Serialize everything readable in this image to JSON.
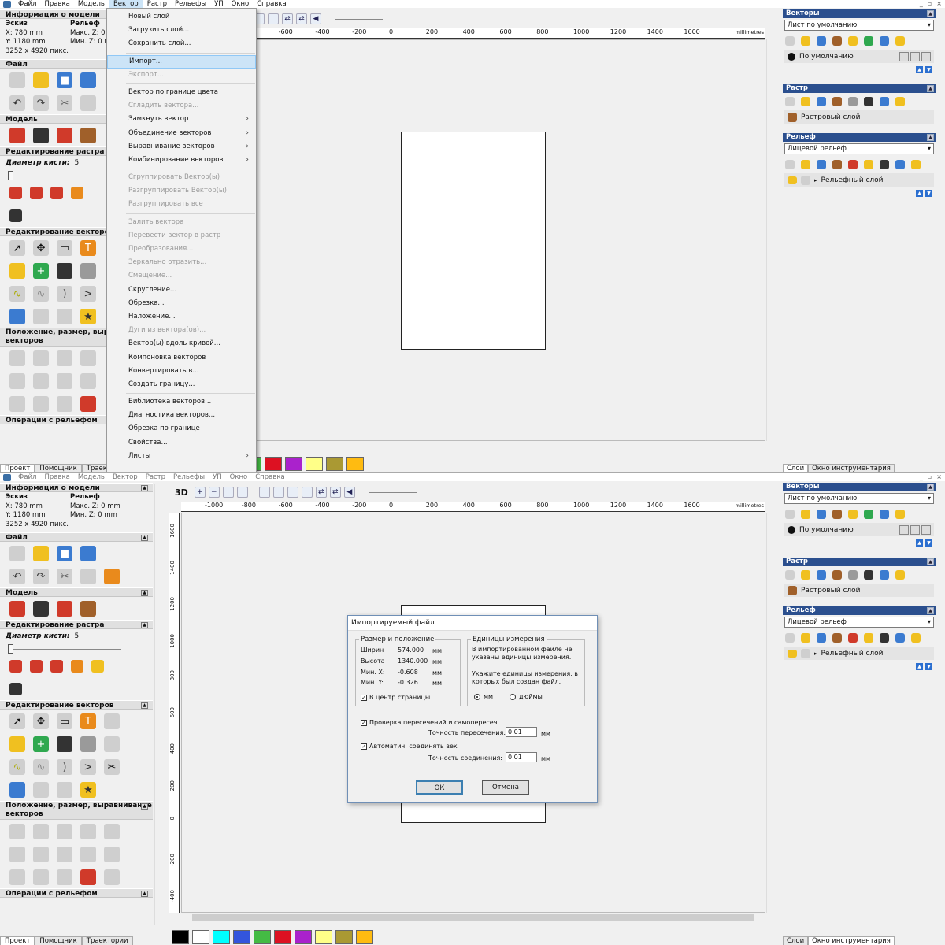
{
  "menubar": {
    "items": [
      "Файл",
      "Правка",
      "Модель",
      "Вектор",
      "Растр",
      "Рельефы",
      "УП",
      "Окно",
      "Справка"
    ],
    "active": "Вектор"
  },
  "left": {
    "model_info_title": "Информация о модели",
    "sketch": "Эскиз",
    "relief": "Рельеф",
    "x": "X: 780 mm",
    "y": "Y: 1180 mm",
    "pixels": "3252 x 4920 пикс.",
    "maxz1": "Макс. Z: 0",
    "minz1": "Мин. Z: 0 п",
    "maxz": "Макс. Z: 0 mm",
    "minz": "Мин. Z: 0 mm",
    "file": "Файл",
    "model": "Модель",
    "raster_edit": "Редактирование растра",
    "brush_label": "Диаметр кисти:",
    "brush_value": "5",
    "vector_edit": "Редактирование векторов",
    "position1": "Положение, размер, вырав",
    "position1b": "векторов",
    "position2": "Положение, размер, выравнивание",
    "position2b": "векторов",
    "relief_ops": "Операции с рельефом",
    "tabs": [
      "Проект",
      "Помощник",
      "Траектории"
    ]
  },
  "menu": {
    "items": [
      {
        "label": "Новый слой",
        "dis": false
      },
      {
        "label": "Загрузить слой...",
        "dis": false
      },
      {
        "label": "Сохранить слой...",
        "dis": false
      },
      {
        "sep": true
      },
      {
        "label": "Импорт...",
        "hi": true
      },
      {
        "label": "Экспорт...",
        "dis": true
      },
      {
        "sep": true
      },
      {
        "label": "Вектор по границе цвета"
      },
      {
        "label": "Сгладить вектора...",
        "dis": true
      },
      {
        "label": "Замкнуть вектор",
        "sub": true
      },
      {
        "label": "Объединение векторов",
        "sub": true
      },
      {
        "label": "Выравнивание векторов",
        "sub": true
      },
      {
        "label": "Комбинирование векторов",
        "sub": true
      },
      {
        "sep": true
      },
      {
        "label": "Сгруппировать Вектор(ы)",
        "dis": true
      },
      {
        "label": "Разгруппировать Вектор(ы)",
        "dis": true
      },
      {
        "label": "Разгруппировать все",
        "dis": true
      },
      {
        "sep": true
      },
      {
        "label": "Залить вектора",
        "dis": true
      },
      {
        "label": "Перевести вектор в растр",
        "dis": true
      },
      {
        "label": "Преобразования...",
        "dis": true
      },
      {
        "label": "Зеркально отразить...",
        "dis": true
      },
      {
        "label": "Смещение...",
        "dis": true
      },
      {
        "label": "Скругление..."
      },
      {
        "label": "Обрезка..."
      },
      {
        "label": "Наложение..."
      },
      {
        "label": "Дуги из вектора(ов)...",
        "dis": true
      },
      {
        "label": "Вектор(ы) вдоль кривой..."
      },
      {
        "label": "Компоновка векторов"
      },
      {
        "label": "Конвертировать в..."
      },
      {
        "label": "Создать границу..."
      },
      {
        "sep": true
      },
      {
        "label": "Библиотека векторов..."
      },
      {
        "label": "Диагностика векторов..."
      },
      {
        "label": "Обрезка по границе"
      },
      {
        "label": "Свойства..."
      },
      {
        "label": "Листы",
        "sub": true
      }
    ]
  },
  "ruler": {
    "unit": "millimetres",
    "ticks": [
      "-1000",
      "-800",
      "-600",
      "-400",
      "-200",
      "0",
      "200",
      "400",
      "600",
      "800",
      "1000",
      "1200",
      "1400",
      "1600"
    ],
    "vticks": [
      "1600",
      "1400",
      "1200",
      "1000",
      "800",
      "600",
      "400",
      "200",
      "0",
      "-200",
      "-400"
    ]
  },
  "toolbar": {
    "label3d": "3D"
  },
  "right": {
    "vectors": "Векторы",
    "sheet": "Лист по умолчанию",
    "default_layer": "По умолчанию",
    "raster": "Растр",
    "raster_layer": "Растровый слой",
    "relief": "Рельеф",
    "front_relief": "Лицевой рельеф",
    "relief_layer": "Рельефный слой",
    "tabs": [
      "Слои",
      "Окно инструментария"
    ]
  },
  "palette": [
    "#000000",
    "#ffffff",
    "#00ffff",
    "#3355dd",
    "#44bb44",
    "#dd1122",
    "#aa22cc",
    "#ffff88",
    "#aa9933",
    "#ffbb11"
  ],
  "dialog": {
    "title": "Импортируемый файл",
    "size_group": "Размер и положение",
    "width_label": "Ширин",
    "width": "574.000",
    "height_label": "Высота",
    "height": "1340.000",
    "minx_label": "Мин. X:",
    "minx": "-0.608",
    "miny_label": "Мин. Y:",
    "miny": "-0.326",
    "mm": "мм",
    "center": "В центр страницы",
    "units_group": "Единицы измерения",
    "units_msg1": "В импортированном файле не указаны единицы измерения.",
    "units_msg2": "Укажите единицы измерения, в которых был создан файл.",
    "opt_mm": "мм",
    "opt_in": "дюймы",
    "check_inter": "Проверка пересечений и самопересеч.",
    "inter_prec_label": "Точность пересечения:",
    "inter_prec": "0.01",
    "auto_join": "Автоматич. соединять век",
    "join_prec_label": "Точность соединения:",
    "join_prec": "0.01",
    "ok": "ОК",
    "cancel": "Отмена"
  }
}
